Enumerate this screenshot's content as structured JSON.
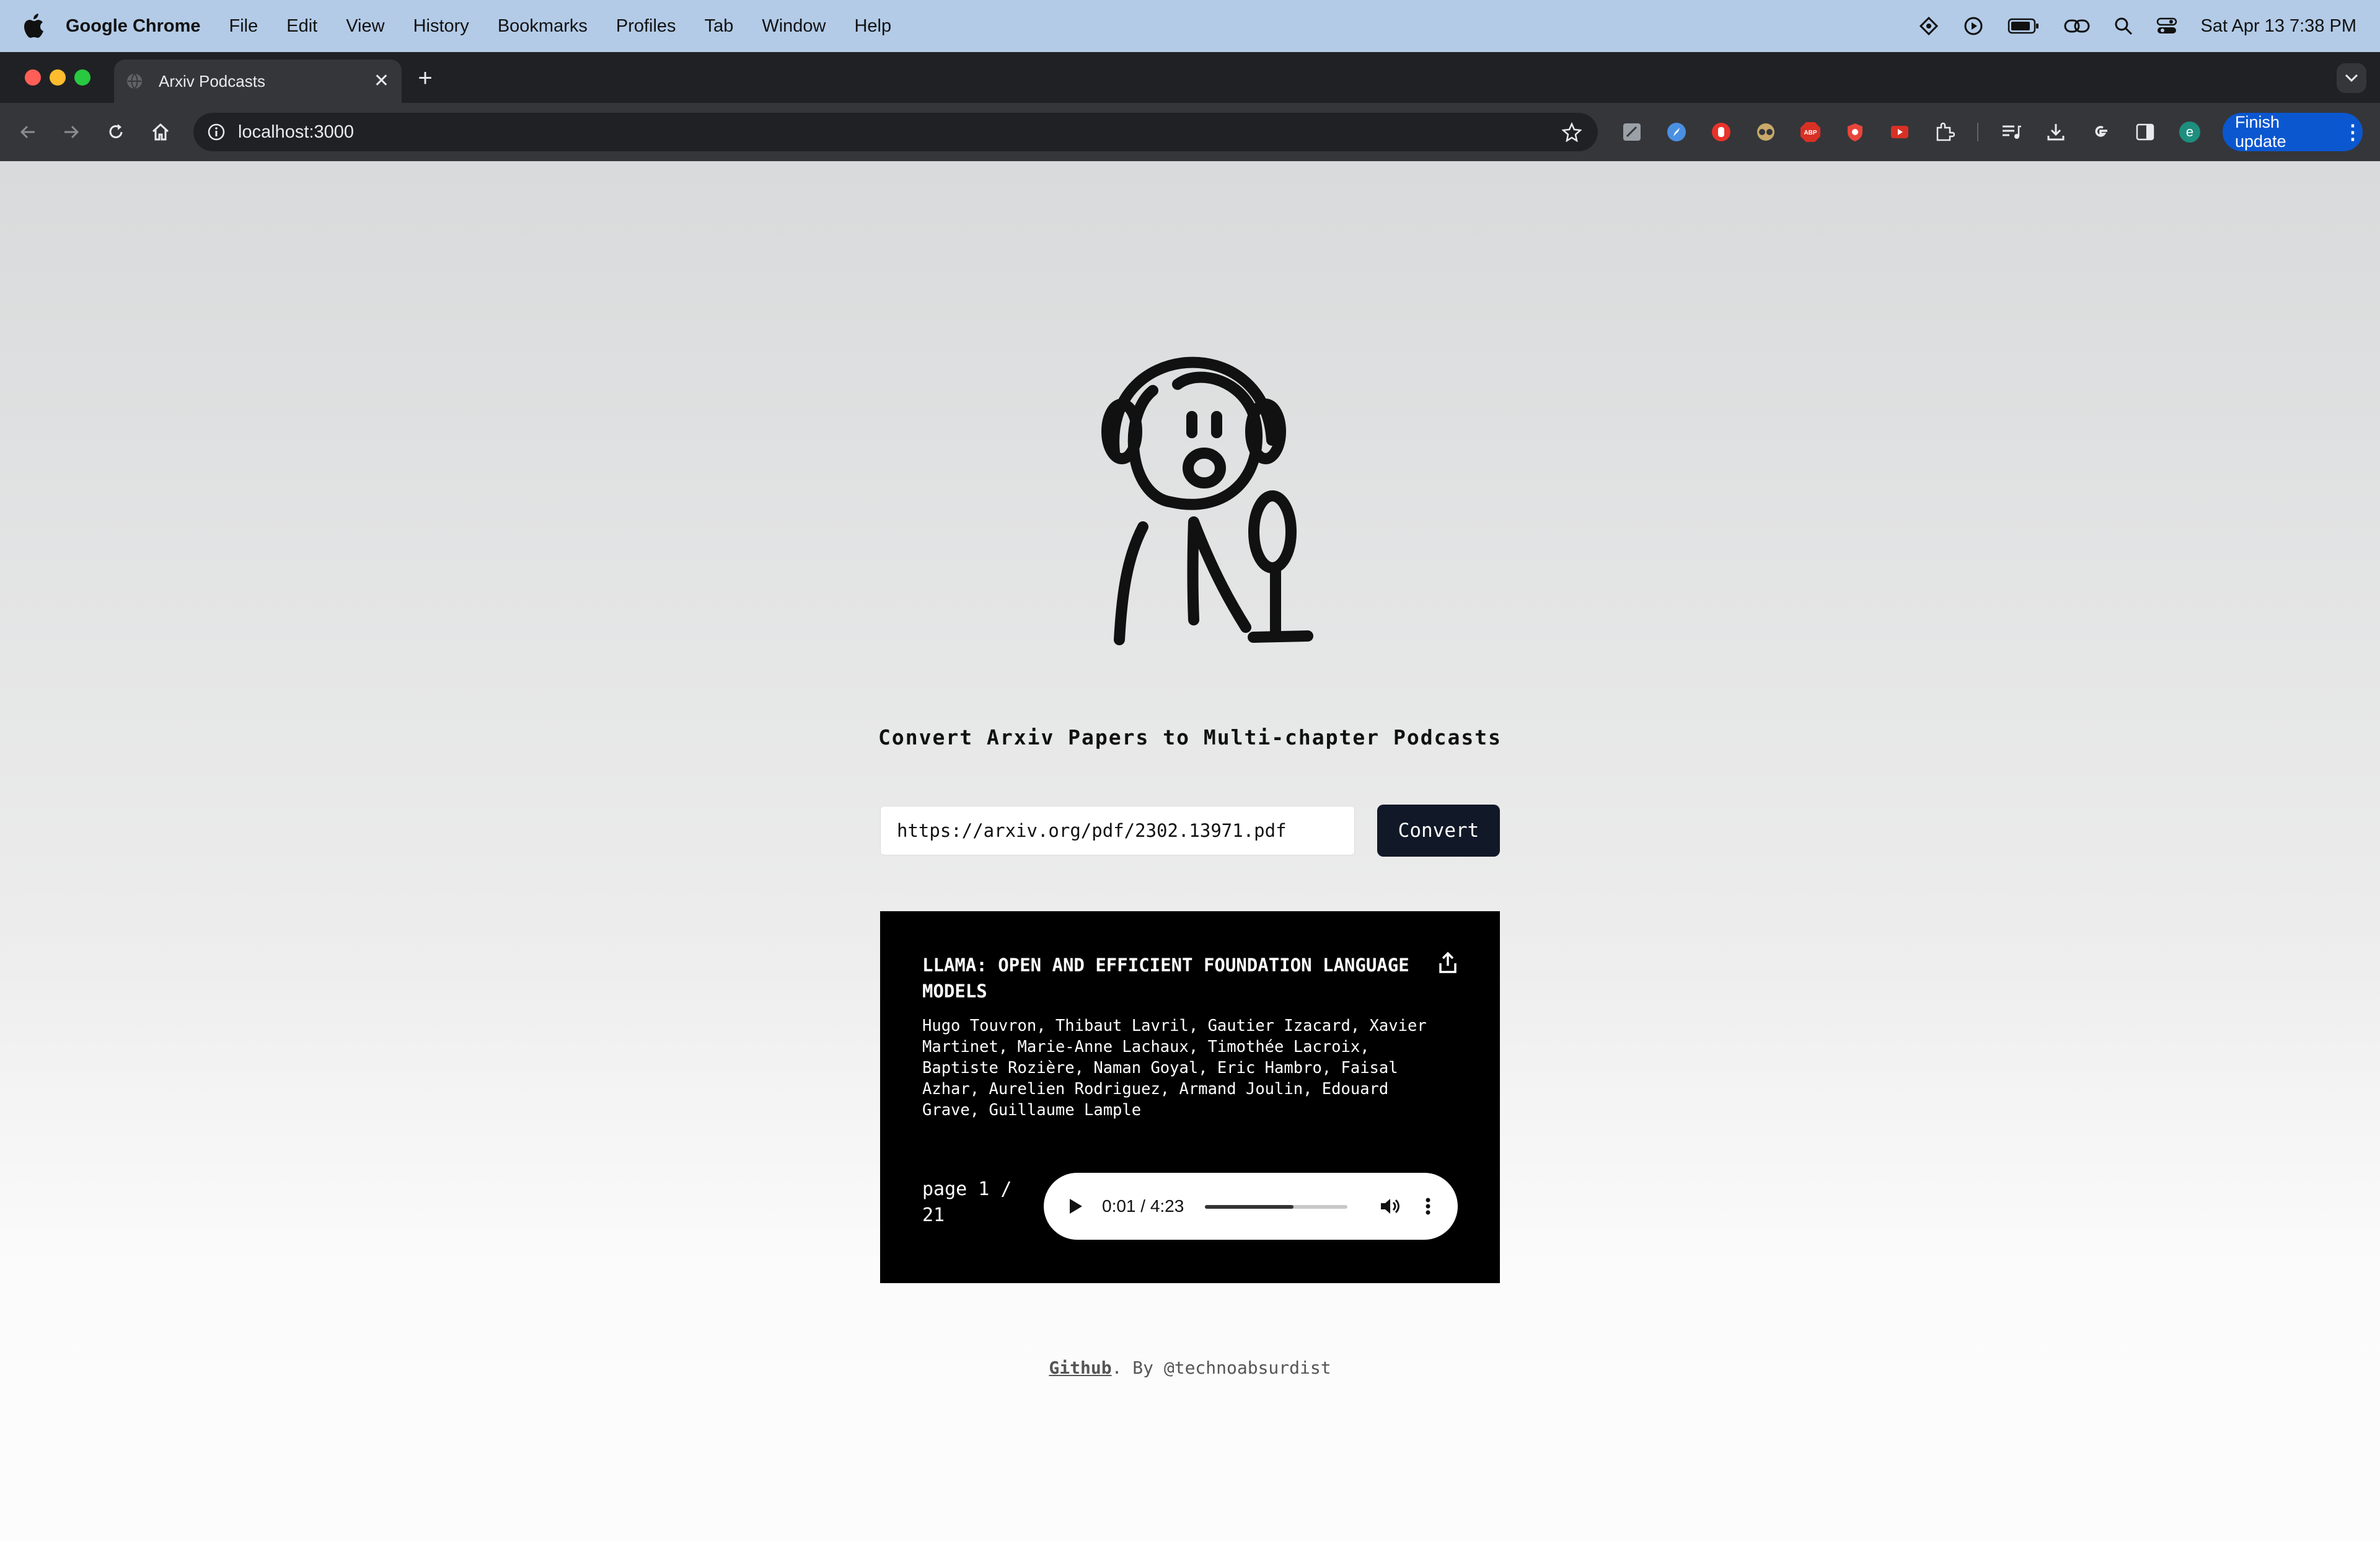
{
  "menubar": {
    "app": "Google Chrome",
    "items": [
      "File",
      "Edit",
      "View",
      "History",
      "Bookmarks",
      "Profiles",
      "Tab",
      "Window",
      "Help"
    ],
    "datetime": "Sat Apr 13  7:38 PM"
  },
  "browser": {
    "tab_title": "Arxiv Podcasts",
    "url": "localhost:3000",
    "finish_update_label": "Finish update",
    "profile_initial": "e",
    "abp_label": "ABP"
  },
  "page": {
    "tagline": "Convert Arxiv Papers to Multi-chapter Podcasts",
    "input_value": "https://arxiv.org/pdf/2302.13971.pdf",
    "convert_label": "Convert",
    "paper": {
      "title": "LLAMA: OPEN AND EFFICIENT FOUNDATION LANGUAGE MODELS",
      "authors": "Hugo Touvron, Thibaut Lavril, Gautier Izacard, Xavier Martinet, Marie-Anne Lachaux, Timothée Lacroix, Baptiste Rozière, Naman Goyal, Eric Hambro, Faisal Azhar, Aurelien Rodriguez, Armand Joulin, Edouard Grave, Guillaume Lample",
      "page_indicator": "page 1 / 21"
    },
    "audio": {
      "time": "0:01 / 4:23",
      "progress": 0.62
    },
    "footer": {
      "link": "Github",
      "text": ". By @technoabsurdist"
    }
  },
  "colors": {
    "menubar": "#b3cbe7",
    "chrome_dark": "#202124",
    "toolbar": "#35363a",
    "finish_update": "#0b57d0",
    "convert_button": "#111827",
    "card": "#000000"
  },
  "icons": [
    "apple-icon",
    "back-icon",
    "forward-icon",
    "reload-icon",
    "home-icon",
    "site-info-icon",
    "star-icon",
    "share-icon",
    "play-icon",
    "volume-icon",
    "more-vert-icon"
  ]
}
